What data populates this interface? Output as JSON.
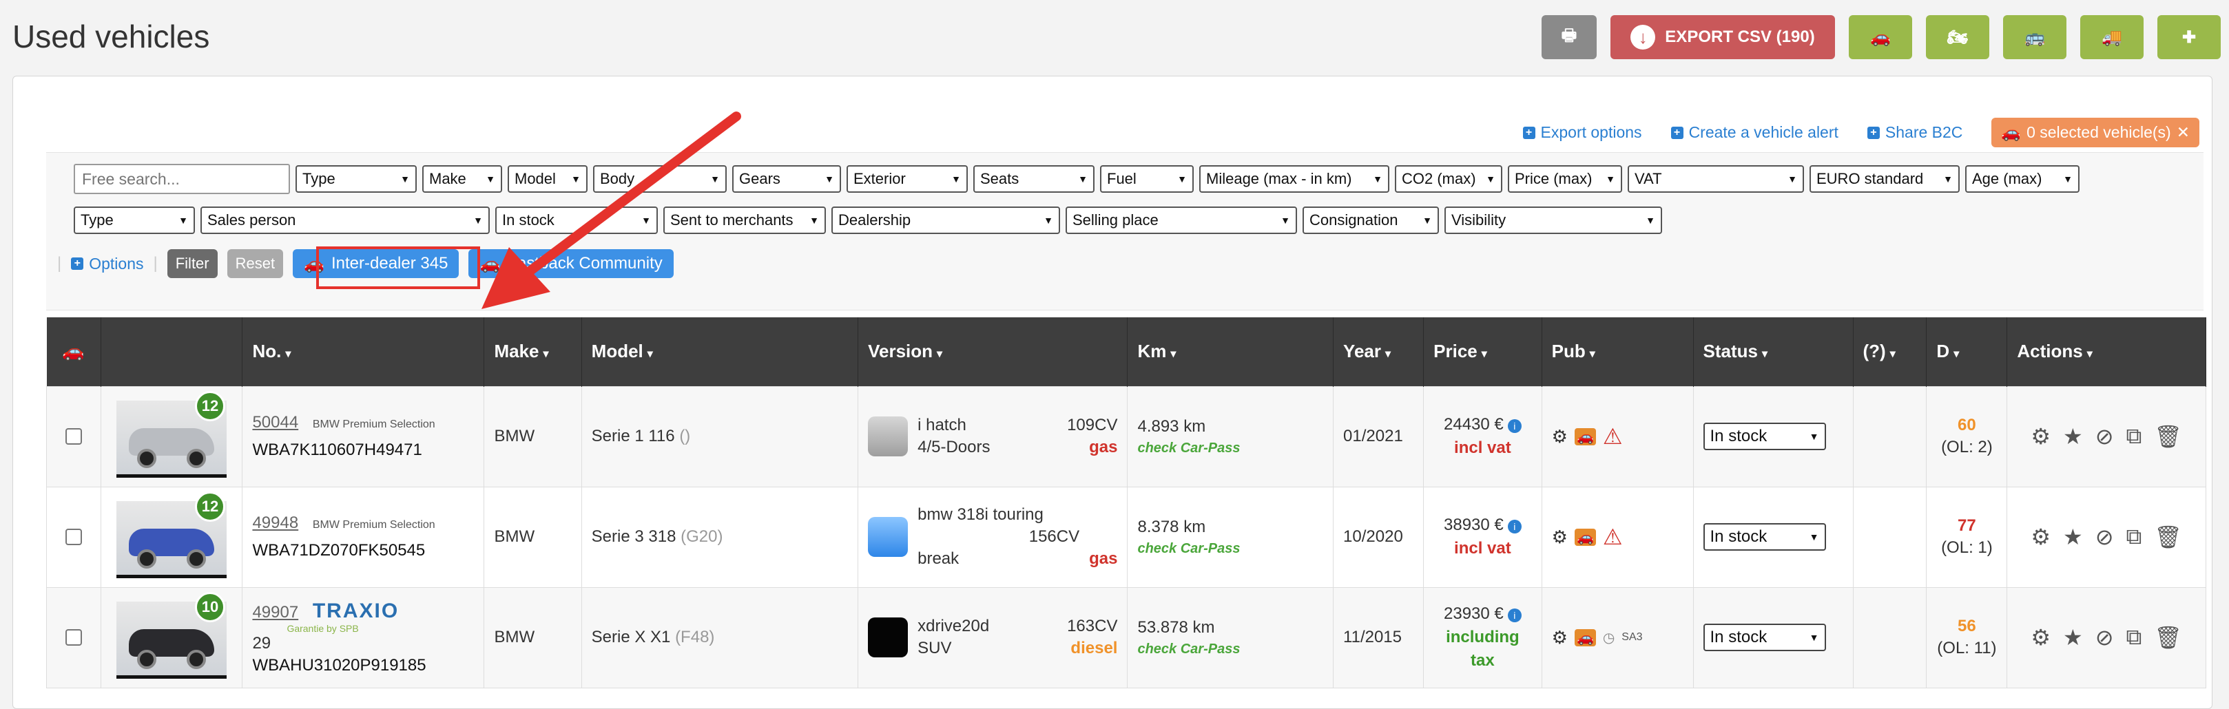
{
  "page": {
    "title": "Used vehicles"
  },
  "top_actions": {
    "export_label": "EXPORT CSV (190)",
    "icons": [
      "print-icon",
      "car-icon",
      "motorcycle-icon",
      "bus-icon",
      "truck-icon",
      "ambulance-icon"
    ]
  },
  "panel_links": {
    "export_options": "Export options",
    "create_alert": "Create a vehicle alert",
    "share_b2c": "Share B2C",
    "selected": "0 selected vehicle(s)"
  },
  "filters": {
    "search_placeholder": "Free search...",
    "row1": [
      "Type",
      "Make",
      "Model",
      "Body",
      "Gears",
      "Exterior",
      "Seats",
      "Fuel",
      "Mileage (max - in km)",
      "CO2 (max)",
      "Price (max)",
      "VAT",
      "EURO standard",
      "Age (max)"
    ],
    "row2": [
      "Type",
      "Sales person",
      "In stock",
      "Sent to merchants",
      "Dealership",
      "Selling place",
      "Consignation",
      "Visibility"
    ],
    "options": "Options",
    "filter": "Filter",
    "reset": "Reset",
    "inter_dealer": "Inter-dealer 345",
    "fastback": "Fastback Community"
  },
  "table": {
    "headers": [
      "No.",
      "Make",
      "Model",
      "Version",
      "Km",
      "Year",
      "Price",
      "Pub",
      "Status",
      "(?)",
      "D",
      "Actions"
    ],
    "rows": [
      {
        "badge": "12",
        "number": "50044",
        "brand": "BMW Premium Selection",
        "vin": "WBA7K110607H49471",
        "make": "BMW",
        "model": "Serie 1 116",
        "model_code": "()",
        "version_line1": "i hatch",
        "version_line2": "4/5-Doors",
        "power": "109CV",
        "fuel": "gas",
        "km": "4.893 km",
        "checkpass": "check Car-Pass",
        "year": "01/2021",
        "price": "24430 €",
        "vat": "incl vat",
        "status": "In stock",
        "d_value": "60",
        "d_ol": "(OL: 2)"
      },
      {
        "badge": "12",
        "number": "49948",
        "brand": "BMW Premium Selection",
        "vin": "WBA71DZ070FK50545",
        "make": "BMW",
        "model": "Serie 3 318",
        "model_code": "(G20)",
        "version_line1": "bmw 318i touring",
        "version_line2": "break",
        "power": "156CV",
        "fuel": "gas",
        "km": "8.378 km",
        "checkpass": "check Car-Pass",
        "year": "10/2020",
        "price": "38930 €",
        "vat": "incl vat",
        "status": "In stock",
        "d_value": "77",
        "d_ol": "(OL: 1)"
      },
      {
        "badge": "10",
        "number": "49907",
        "extra": "29",
        "brand_logo": "TRAXIO",
        "brand_sub": "Garantie by SPB",
        "vin": "WBAHU31020P919185",
        "make": "BMW",
        "model": "Serie X X1",
        "model_code": "(F48)",
        "version_line1": "xdrive20d",
        "version_line2": "SUV",
        "power": "163CV",
        "fuel": "diesel",
        "km": "53.878 km",
        "checkpass": "check Car-Pass",
        "year": "11/2015",
        "price": "23930 €",
        "vat": "including tax",
        "pub_extra": "SA3",
        "status": "In stock",
        "d_value": "56",
        "d_ol": "(OL: 11)"
      }
    ]
  },
  "colors": {
    "blue": "#3d91e6",
    "green": "#9ab94a",
    "red": "#c9585a",
    "highlight": "#e5322c"
  }
}
